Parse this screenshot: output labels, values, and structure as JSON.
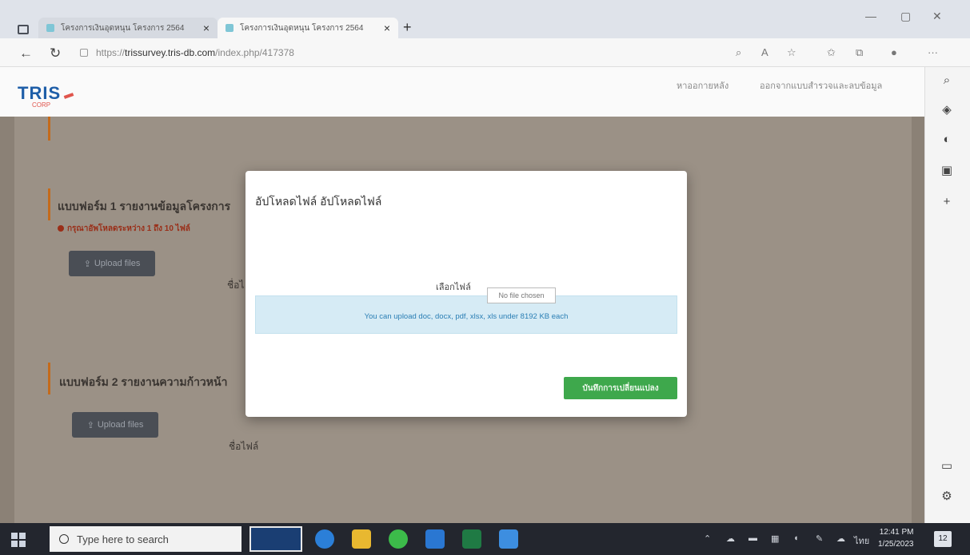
{
  "browser": {
    "tabs": [
      {
        "title": "โครงการเงินอุดหนุน โครงการ 2564",
        "active": false
      },
      {
        "title": "โครงการเงินอุดหนุน โครงการ 2564",
        "active": true
      }
    ],
    "url_scheme": "https://",
    "url_host": "trissurvey.tris-db.com",
    "url_path": "/index.php/417378"
  },
  "site": {
    "logo_text": "TRIS",
    "logo_sub": "CORP",
    "nav": [
      "หาออกายหลัง",
      "ออกจากแบบสำรวจและลบข้อมูล"
    ]
  },
  "page": {
    "form1_title": "แบบฟอร์ม 1 รายงานข้อมูลโครงการ",
    "form1_warning": "กรุณาอัพโหลดระหว่าง 1 ถึง 10 ไฟล์",
    "form1_upload": "Upload files",
    "form1_filename": "ชื่อไ",
    "form2_title": "แบบฟอร์ม 2 รายงานความก้าวหน้า",
    "form2_upload": "Upload files",
    "form2_filename": "ชื่อไฟล์"
  },
  "modal": {
    "title": "อัปโหลดไฟล์ อัปโหลดไฟล์",
    "file_label": "เลือกไฟล์",
    "file_input_value": "No file chosen",
    "info": "You can upload doc, docx, pdf, xlsx, xls under 8192 KB each",
    "save_button": "บันทึกการเปลี่ยนแปลง",
    "save_color": "#3ea84c",
    "info_color": "#d6ebf5"
  },
  "taskbar": {
    "search_placeholder": "Type here to search",
    "time": "12:41 PM",
    "date": "1/25/2023",
    "lang": "ไทย",
    "notifications": "12"
  }
}
